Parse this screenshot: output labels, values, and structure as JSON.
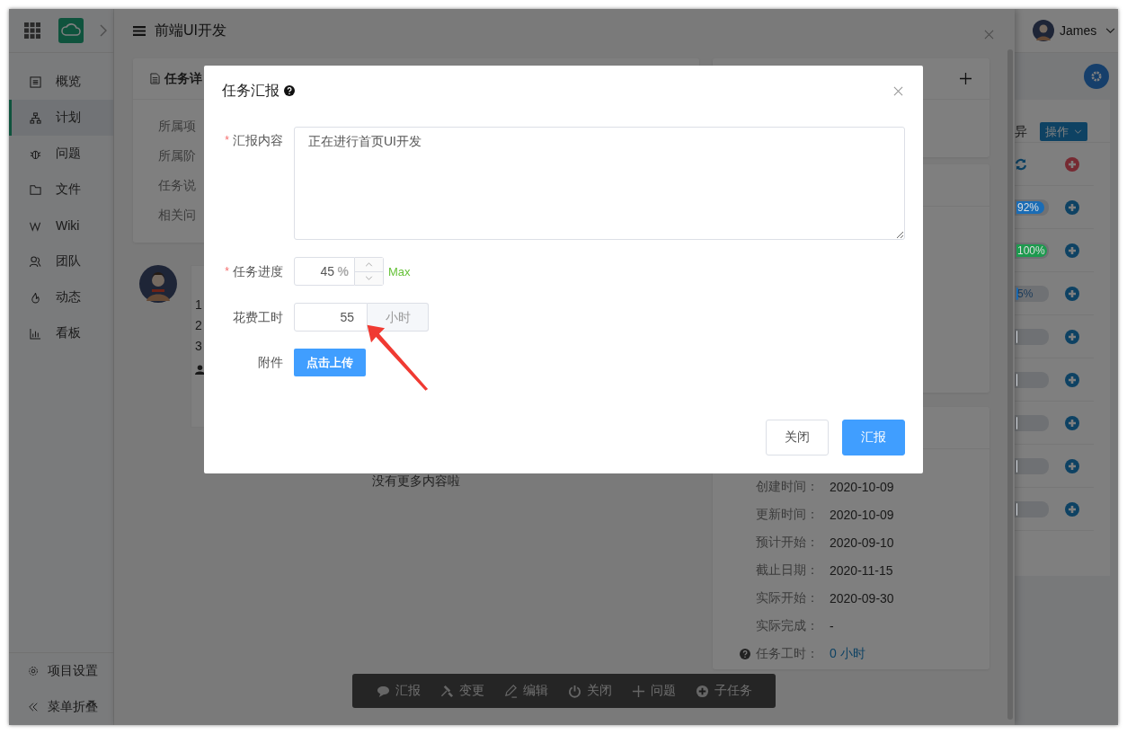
{
  "header": {
    "user_name": "James"
  },
  "sidebar": {
    "items": [
      {
        "label": "概览",
        "selected": false
      },
      {
        "label": "计划",
        "selected": true
      },
      {
        "label": "问题",
        "selected": false
      },
      {
        "label": "文件",
        "selected": false
      },
      {
        "label": "Wiki",
        "selected": false
      },
      {
        "label": "团队",
        "selected": false
      },
      {
        "label": "动态",
        "selected": false
      },
      {
        "label": "看板",
        "selected": false
      }
    ],
    "footer": [
      "项目设置",
      "菜单折叠"
    ]
  },
  "drawer": {
    "title": "前端UI开发",
    "detail_card": {
      "title": "任务详",
      "fields": [
        "所属项",
        "所属阶",
        "任务说",
        "相关问"
      ]
    },
    "comment": {
      "lines": [
        "1",
        "2",
        "3"
      ]
    },
    "end_note": "没有更多内容啦",
    "info_card": {
      "rows": [
        {
          "kind": "text",
          "label": "创建时间：",
          "value": "2020-10-09"
        },
        {
          "kind": "text",
          "label": "更新时间：",
          "value": "2020-10-09"
        },
        {
          "kind": "text",
          "label": "预计开始：",
          "value": "2020-09-10"
        },
        {
          "kind": "text",
          "label": "截止日期：",
          "value": "2020-11-15"
        },
        {
          "kind": "text",
          "label": "实际开始：",
          "value": "2020-09-30"
        },
        {
          "kind": "text",
          "label": "实际完成：",
          "value": "-"
        },
        {
          "kind": "link",
          "label": "任务工时：",
          "value": "0 小时"
        }
      ]
    },
    "toolbar": [
      "汇报",
      "变更",
      "编辑",
      "关闭",
      "问题",
      "子任务"
    ]
  },
  "table": {
    "header": "异",
    "action_button": "操作",
    "rows": [
      {
        "kind": "icons"
      },
      {
        "kind": "progress",
        "label": "92%",
        "level": 0.92,
        "color": "#1a6cb5"
      },
      {
        "kind": "progress",
        "label": "100%",
        "level": 1,
        "color": "#1d9a4e"
      },
      {
        "kind": "progress",
        "label": "5%",
        "level": 0.05,
        "color": "#1a6cb5"
      },
      {
        "kind": "progress",
        "level": 0
      },
      {
        "kind": "progress",
        "level": 0
      },
      {
        "kind": "progress",
        "level": 0
      },
      {
        "kind": "progress",
        "level": 0
      },
      {
        "kind": "progress",
        "level": 0
      }
    ]
  },
  "modal": {
    "title": "任务汇报",
    "fields": [
      {
        "kind": "textarea",
        "label": "汇报内容",
        "required_mark": "*",
        "value": "正在进行首页UI开发"
      },
      {
        "kind": "stepper",
        "label": "任务进度",
        "required_mark": "*",
        "value": "45",
        "suffix": "%",
        "hint": "Max"
      },
      {
        "kind": "addon",
        "label": "花费工时",
        "value": "55",
        "addon": "小时"
      },
      {
        "kind": "upload",
        "label": "附件",
        "button": "点击上传"
      }
    ],
    "buttons": [
      {
        "label": "关闭",
        "primary": false
      },
      {
        "label": "汇报",
        "primary": true
      }
    ]
  }
}
